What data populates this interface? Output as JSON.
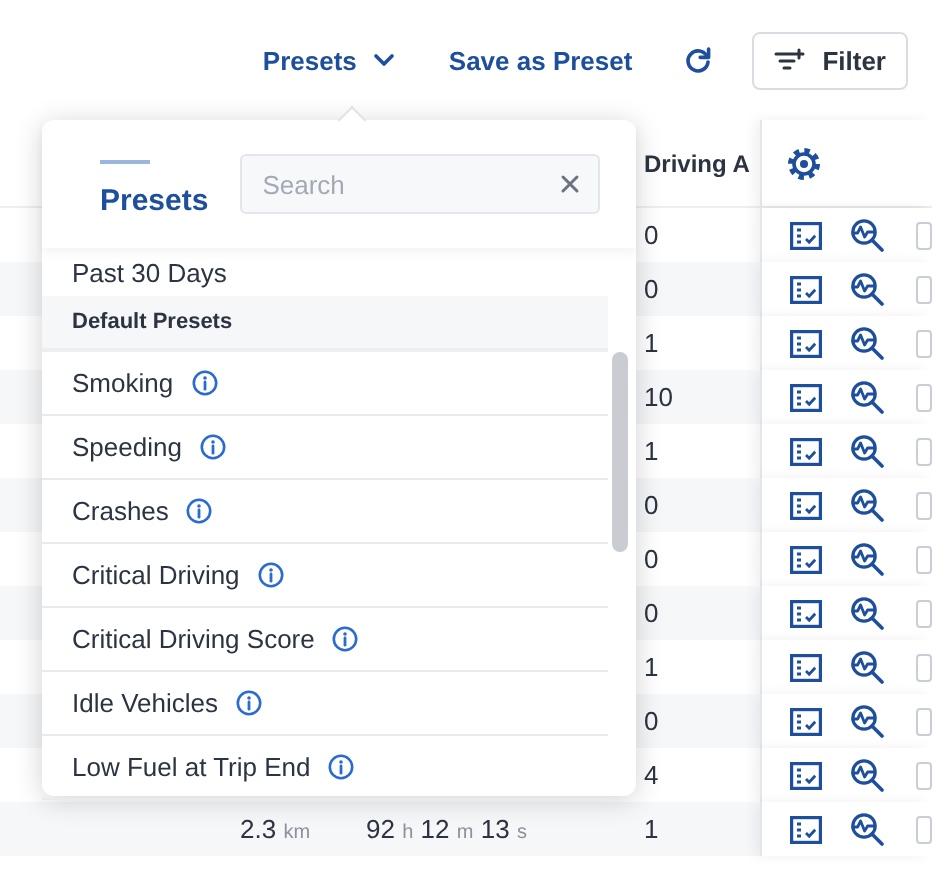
{
  "toolbar": {
    "presets_button": "Presets",
    "save_button": "Save as Preset",
    "filter_button": "Filter"
  },
  "table": {
    "header": "Driving A",
    "rows": [
      {
        "count": "0",
        "checked": false
      },
      {
        "count": "0",
        "checked": false
      },
      {
        "count": "1",
        "checked": false
      },
      {
        "count": "10",
        "checked": false
      },
      {
        "count": "1",
        "checked": false
      },
      {
        "count": "0",
        "checked": false
      },
      {
        "count": "0",
        "checked": false
      },
      {
        "count": "0",
        "checked": false
      },
      {
        "count": "1",
        "checked": false
      },
      {
        "count": "0",
        "checked": false
      },
      {
        "count": "4",
        "checked": false
      },
      {
        "count": "1",
        "checked": false,
        "distance": {
          "value": "2.3",
          "unit": "km"
        },
        "duration": [
          {
            "value": "92",
            "unit": "h"
          },
          {
            "value": "12",
            "unit": "m"
          },
          {
            "value": "13",
            "unit": "s"
          }
        ]
      }
    ]
  },
  "presets_popup": {
    "tab": "Presets",
    "search": {
      "placeholder": "Search"
    },
    "items": [
      {
        "kind": "item",
        "label": "Past 30 Days",
        "info": false
      },
      {
        "kind": "header",
        "label": "Default Presets"
      },
      {
        "kind": "item",
        "label": "Smoking",
        "info": true
      },
      {
        "kind": "item",
        "label": "Speeding",
        "info": true
      },
      {
        "kind": "item",
        "label": "Crashes",
        "info": true
      },
      {
        "kind": "item",
        "label": "Critical Driving",
        "info": true
      },
      {
        "kind": "item",
        "label": "Critical Driving Score",
        "info": true
      },
      {
        "kind": "item",
        "label": "Idle Vehicles",
        "info": true
      },
      {
        "kind": "item",
        "label": "Low Fuel at Trip End",
        "info": true
      }
    ]
  }
}
